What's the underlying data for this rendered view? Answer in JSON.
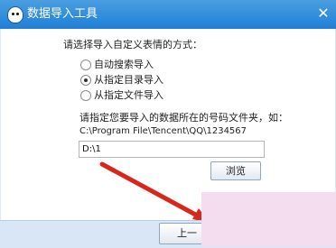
{
  "window": {
    "title": "数据导入工具",
    "close_glyph": "✕"
  },
  "prompt": "请选择导入自定义表情的方式：",
  "options": [
    {
      "label": "自动搜索导入",
      "checked": false
    },
    {
      "label": "从指定目录导入",
      "checked": true
    },
    {
      "label": "从指定文件导入",
      "checked": false
    }
  ],
  "hint": "请指定您要导入的数据所在的号码文件夹，如：",
  "example_path": "C:\\Program File\\Tencent\\QQ\\1234567",
  "path_value": "D:\\1",
  "browse_label": "浏览",
  "prev_label": "上一",
  "colors": {
    "titlebar": "#1f7fd6",
    "arrow": "#d9261c"
  },
  "icons": {
    "app": "qq-penguin-icon",
    "close": "close-icon"
  }
}
